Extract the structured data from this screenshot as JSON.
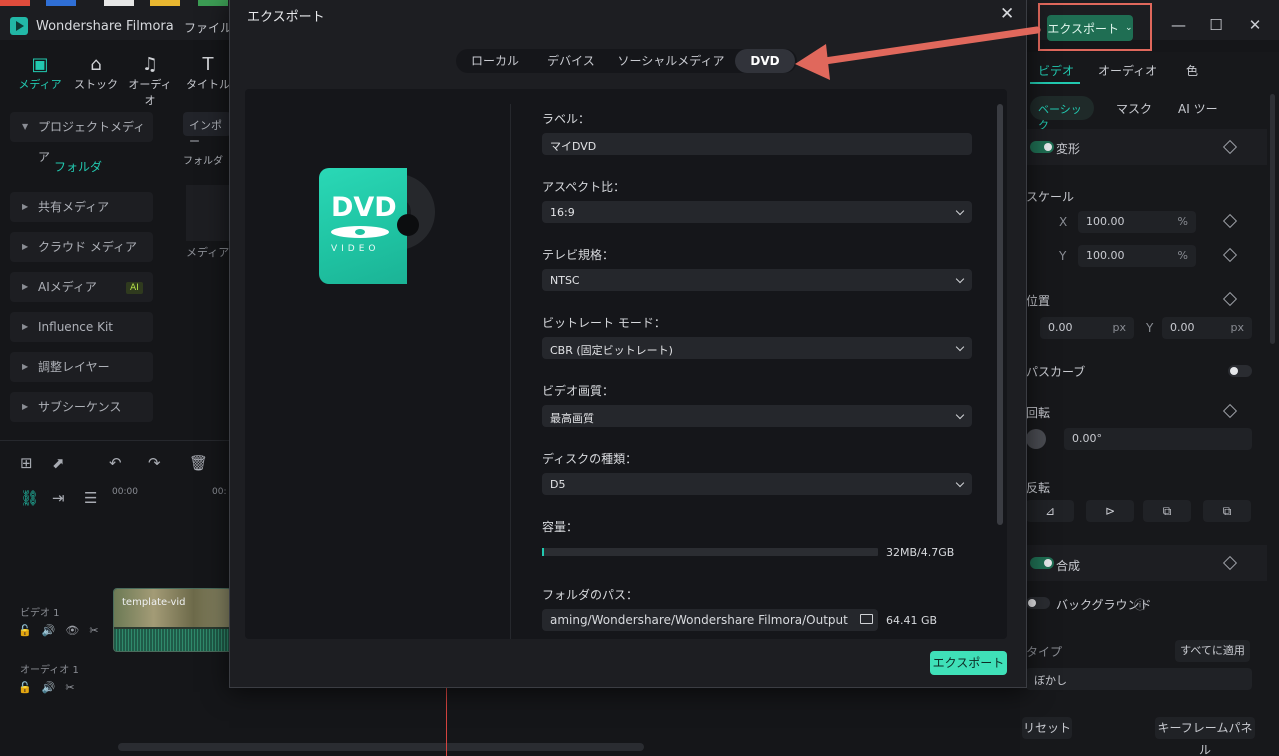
{
  "app": {
    "name": "Wondershare Filmora",
    "menu_file": "ファイル",
    "export_label": "エクスポート"
  },
  "tools": [
    {
      "label": "メディア",
      "icon": "media-icon"
    },
    {
      "label": "ストック",
      "icon": "stock-icon"
    },
    {
      "label": "オーディオ",
      "icon": "audio-icon"
    },
    {
      "label": "タイトル",
      "icon": "title-icon"
    }
  ],
  "sidebar": {
    "items": [
      {
        "label": "プロジェクトメディア"
      },
      {
        "label": "フォルダ"
      },
      {
        "label": "共有メディア"
      },
      {
        "label": "クラウド メディア"
      },
      {
        "label": "AIメディア",
        "badge": "AI"
      },
      {
        "label": "Influence Kit"
      },
      {
        "label": "調整レイヤー"
      },
      {
        "label": "サブシーケンス"
      }
    ]
  },
  "media": {
    "import_label": "インポー",
    "folder_label": "フォルダ",
    "hint": "メディアを"
  },
  "timeline": {
    "ruler_start": "00:00",
    "ruler_next": "00:",
    "video_track": "ビデオ 1",
    "audio_track": "オーディオ 1",
    "clip_name": "template-vid"
  },
  "right_panel": {
    "tabs": [
      "ビデオ",
      "オーディオ",
      "色"
    ],
    "subtabs": [
      "ベーシック",
      "マスク",
      "AI ツー"
    ],
    "transform": "変形",
    "scale": "スケール",
    "x_label": "X",
    "y_label": "Y",
    "scale_x": "100.00",
    "scale_y": "100.00",
    "percent": "%",
    "position": "位置",
    "pos_x": "0.00",
    "pos_y": "0.00",
    "px": "px",
    "bezier": "パスカーブ",
    "rotation": "回転",
    "rotation_value": "0.00°",
    "flip": "反転",
    "composite": "合成",
    "background": "バックグラウンド",
    "type_label": "タイプ",
    "apply_all": "すべてに適用",
    "blur": "ぼかし",
    "reset": "リセット",
    "keyframe_panel": "キーフレームパネル"
  },
  "dialog": {
    "title": "エクスポート",
    "tabs": [
      {
        "label": "ローカル",
        "active": false
      },
      {
        "label": "デバイス",
        "active": false
      },
      {
        "label": "ソーシャルメディア",
        "active": false
      },
      {
        "label": "DVD",
        "active": true
      }
    ],
    "dvd_logo": "DVD",
    "dvd_sub": "VIDEO",
    "fields": {
      "label_title": "ラベル：",
      "label_value": "マイDVD",
      "aspect_title": "アスペクト比：",
      "aspect_value": "16:9",
      "tv_title": "テレビ規格：",
      "tv_value": "NTSC",
      "bitrate_title": "ビットレート モード：",
      "bitrate_value": "CBR (固定ビットレート)",
      "quality_title": "ビデオ画質：",
      "quality_value": "最高画質",
      "disc_title": "ディスクの種類：",
      "disc_value": "D5",
      "capacity_title": "容量：",
      "capacity_text": "32MB/4.7GB",
      "capacity_fraction": 0.0068,
      "folder_title": "フォルダのパス：",
      "folder_value": "aming/Wondershare/Wondershare Filmora/Output",
      "free_space": "64.41 GB"
    },
    "export_button": "エクスポート"
  },
  "colors": {
    "accent": "#22c9b0",
    "export_button": "#3fe0b8",
    "highlight_box": "#e0685c"
  }
}
